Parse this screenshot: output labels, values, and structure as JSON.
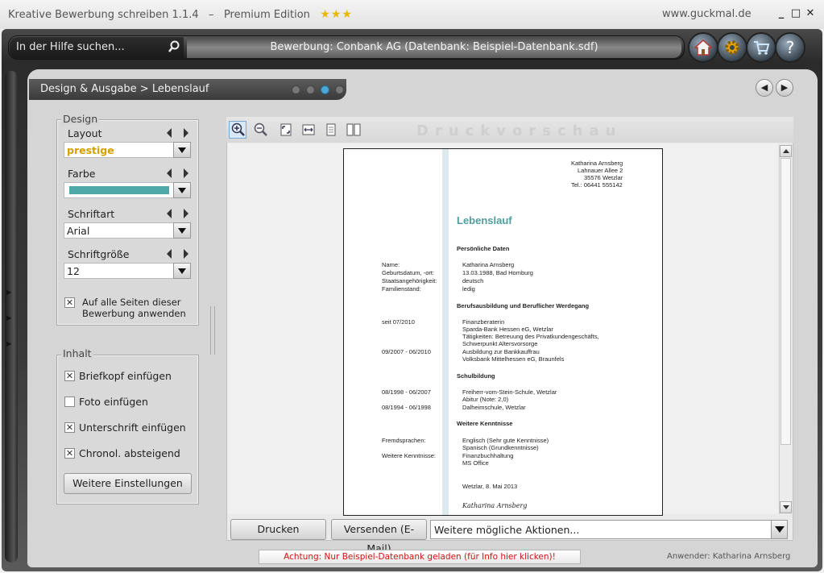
{
  "window": {
    "title": "Kreative Bewerbung schreiben 1.1.4",
    "separator": "–",
    "edition": "Premium Edition",
    "stars": "★★★",
    "site": "www.guckmal.de",
    "minimize": "_",
    "maximize": "□",
    "close": "✕"
  },
  "topbar": {
    "search_placeholder": "In der Hilfe suchen...",
    "document_info": "Bewerbung: Conbank AG (Datenbank: Beispiel-Datenbank.sdf)",
    "nav_icons": [
      "home-icon",
      "settings-icon",
      "cart-icon",
      "help-icon"
    ]
  },
  "breadcrumb": {
    "text": "Design & Ausgabe > Lebenslauf",
    "active_step": 3
  },
  "design": {
    "legend": "Design",
    "layout": {
      "label": "Layout",
      "value": "prestige",
      "value_color": "#d4a000"
    },
    "farbe": {
      "label": "Farbe",
      "color": "#4fa8a8"
    },
    "schriftart": {
      "label": "Schriftart",
      "value": "Arial"
    },
    "schriftgroesse": {
      "label": "Schriftgröße",
      "value": "12"
    },
    "apply_all": {
      "line1": "Auf alle Seiten dieser",
      "line2": "Bewerbung anwenden",
      "checked": true
    }
  },
  "inhalt": {
    "legend": "Inhalt",
    "options": [
      {
        "label": "Briefkopf einfügen",
        "checked": true
      },
      {
        "label": "Foto einfügen",
        "checked": false
      },
      {
        "label": "Unterschrift einfügen",
        "checked": true
      },
      {
        "label": "Chronol. absteigend",
        "checked": true
      }
    ],
    "more_button": "Weitere Einstellungen"
  },
  "preview": {
    "title": "Druckvorschau",
    "tools": [
      "zoom-in-icon",
      "zoom-out-icon",
      "fit-page-icon",
      "fit-width-icon",
      "single-page-icon",
      "two-page-icon"
    ],
    "doc": {
      "sender": [
        "Katharina Arnsberg",
        "Lahnauer Allee 2",
        "35576 Wetzlar",
        "Tel.: 06441 555142"
      ],
      "heading": "Lebenslauf",
      "s1": "Persönliche Daten",
      "personal_labels": [
        "Name:",
        "Geburtsdatum, -ort:",
        "Staatsangehörigkeit:",
        "Familienstand:"
      ],
      "personal_values": [
        "Katharina Arnsberg",
        "13.03.1988, Bad Homburg",
        "deutsch",
        "ledig"
      ],
      "s2": "Berufsausbildung und Beruflicher Werdegang",
      "job1_date": "seit 07/2010",
      "job1_lines": [
        "Finanzberaterin",
        "Sparda-Bank Hessen eG, Wetzlar",
        "Tätigkeiten: Betreuung des Privatkundengeschäfts,",
        "Schwerpunkt Altersvorsorge"
      ],
      "job2_date": "09/2007 - 06/2010",
      "job2_lines": [
        "Ausbildung zur Bankkauffrau",
        "Volksbank Mittelhessen eG, Braunfels"
      ],
      "s3": "Schulbildung",
      "school1_date": "08/1998 - 06/2007",
      "school1_lines": [
        "Freiherr-vom-Stein-Schule, Wetzlar",
        "Abitur (Note: 2,0)"
      ],
      "school2_date": "08/1994 - 06/1998",
      "school2_lines": [
        "Dalheimschule, Wetzlar"
      ],
      "s4": "Weitere Kenntnisse",
      "k1_label": "Fremdsprachen:",
      "k1_lines": [
        "Englisch (Sehr gute Kenntnisse)",
        "Spanisch (Grundkenntnisse)"
      ],
      "k2_label": "Weitere Kenntnisse:",
      "k2_lines": [
        "Finanzbuchhaltung",
        "MS Office"
      ],
      "place_date": "Wetzlar, 8. Mai 2013",
      "signature": "Katharina Arnsberg"
    }
  },
  "actions": {
    "print": "Drucken",
    "send": "Versenden (E-Mail)",
    "more": "Weitere mögliche Aktionen..."
  },
  "status": {
    "warning": "Achtung: Nur Beispiel-Datenbank geladen (für Info hier klicken)!",
    "user": "Anwender: Katharina Arnsberg"
  }
}
